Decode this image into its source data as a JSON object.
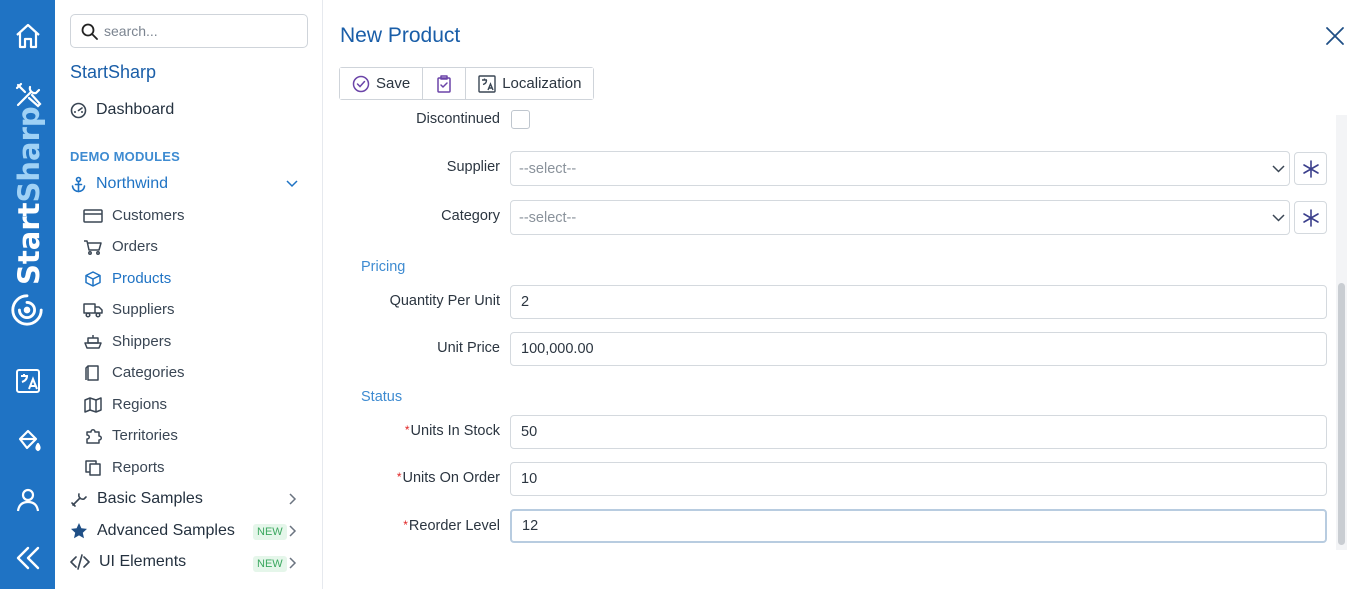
{
  "rail": {
    "brand_first": "Start",
    "brand_second": "Sharp",
    "icons": [
      "home-icon",
      "tools-icon",
      "translate-icon",
      "paint-bucket-icon",
      "user-icon",
      "collapse-icon"
    ],
    "color": "#1f73c4"
  },
  "sidebar": {
    "search_placeholder": "search...",
    "app_title": "StartSharp",
    "dashboard": "Dashboard",
    "section": "DEMO MODULES",
    "northwind": "Northwind",
    "items": [
      {
        "label": "Customers",
        "icon": "card-icon"
      },
      {
        "label": "Orders",
        "icon": "cart-icon"
      },
      {
        "label": "Products",
        "icon": "box-icon",
        "active": true
      },
      {
        "label": "Suppliers",
        "icon": "truck-icon"
      },
      {
        "label": "Shippers",
        "icon": "ship-icon"
      },
      {
        "label": "Categories",
        "icon": "folder-icon"
      },
      {
        "label": "Regions",
        "icon": "map-icon"
      },
      {
        "label": "Territories",
        "icon": "puzzle-icon"
      },
      {
        "label": "Reports",
        "icon": "report-icon"
      }
    ],
    "basic_samples": "Basic Samples",
    "advanced_samples": "Advanced Samples",
    "ui_elements": "UI Elements",
    "new_badge": "NEW"
  },
  "main": {
    "title": "New Product",
    "toolbar": {
      "save": "Save",
      "localization": "Localization"
    },
    "fields": {
      "discontinued": "Discontinued",
      "supplier": "Supplier",
      "supplier_placeholder": "--select--",
      "category": "Category",
      "category_placeholder": "--select--",
      "pricing_header": "Pricing",
      "quantity_per_unit": "Quantity Per Unit",
      "quantity_per_unit_value": "2",
      "unit_price": "Unit Price",
      "unit_price_value": "100,000.00",
      "status_header": "Status",
      "units_in_stock": "Units In Stock",
      "units_in_stock_value": "50",
      "units_on_order": "Units On Order",
      "units_on_order_value": "10",
      "reorder_level": "Reorder Level",
      "reorder_level_value": "12",
      "required_mark": "*"
    }
  }
}
